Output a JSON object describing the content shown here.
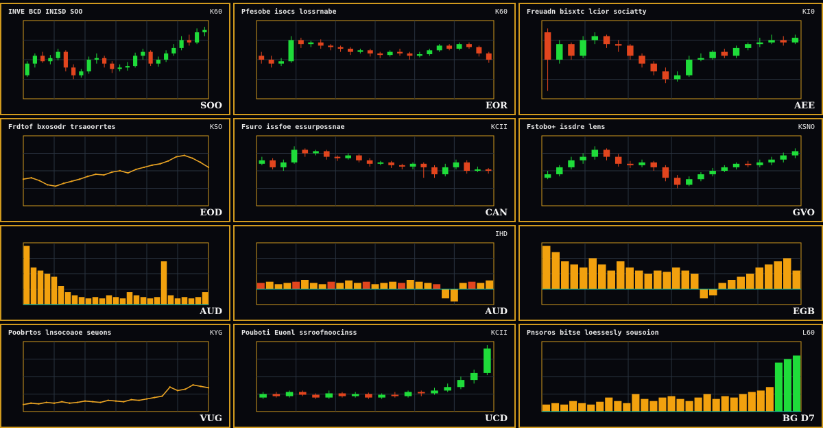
{
  "colors": {
    "background": "#05060a",
    "frame": "#d19a1e",
    "grid": "#2a3340",
    "up": "#1fdc3a",
    "down": "#e2451e",
    "orange": "#f2a10e",
    "line": "#e8a52a",
    "teal": "#19b6a0"
  },
  "chart_data": [
    {
      "id": "p1",
      "type": "candlestick",
      "title": "INVE BCD INISD SOO",
      "code": "K60",
      "currency": "SOO",
      "y": [
        0,
        100
      ],
      "series": [
        [
          30,
          45,
          28,
          48
        ],
        [
          45,
          55,
          40,
          58
        ],
        [
          55,
          48,
          46,
          60
        ],
        [
          48,
          52,
          44,
          56
        ],
        [
          52,
          60,
          49,
          64
        ],
        [
          60,
          40,
          35,
          62
        ],
        [
          40,
          30,
          25,
          44
        ],
        [
          30,
          35,
          27,
          38
        ],
        [
          35,
          50,
          32,
          54
        ],
        [
          50,
          52,
          45,
          58
        ],
        [
          52,
          45,
          40,
          55
        ],
        [
          45,
          38,
          33,
          48
        ],
        [
          38,
          40,
          35,
          44
        ],
        [
          40,
          42,
          36,
          47
        ],
        [
          42,
          55,
          40,
          59
        ],
        [
          55,
          60,
          50,
          64
        ],
        [
          60,
          45,
          42,
          62
        ],
        [
          45,
          50,
          41,
          54
        ],
        [
          50,
          58,
          47,
          62
        ],
        [
          58,
          65,
          55,
          70
        ],
        [
          65,
          75,
          62,
          80
        ],
        [
          75,
          72,
          68,
          82
        ],
        [
          72,
          85,
          70,
          90
        ],
        [
          85,
          88,
          80,
          92
        ]
      ]
    },
    {
      "id": "p2",
      "type": "candlestick",
      "title": "Pfesobe isocs lossrnabe",
      "code": "K60",
      "currency": "EOR",
      "y": [
        0,
        100
      ],
      "series": [
        [
          55,
          50,
          45,
          60
        ],
        [
          50,
          45,
          40,
          55
        ],
        [
          45,
          48,
          42,
          52
        ],
        [
          48,
          75,
          46,
          80
        ],
        [
          75,
          70,
          65,
          78
        ],
        [
          70,
          72,
          66,
          74
        ],
        [
          72,
          68,
          64,
          76
        ],
        [
          68,
          66,
          62,
          70
        ],
        [
          66,
          64,
          60,
          68
        ],
        [
          64,
          60,
          56,
          66
        ],
        [
          60,
          62,
          58,
          64
        ],
        [
          62,
          58,
          54,
          64
        ],
        [
          58,
          56,
          52,
          60
        ],
        [
          56,
          60,
          54,
          62
        ],
        [
          60,
          58,
          55,
          64
        ],
        [
          58,
          55,
          50,
          60
        ],
        [
          55,
          57,
          53,
          60
        ],
        [
          57,
          62,
          55,
          64
        ],
        [
          62,
          68,
          60,
          70
        ],
        [
          68,
          64,
          62,
          70
        ],
        [
          64,
          70,
          62,
          72
        ],
        [
          70,
          66,
          64,
          72
        ],
        [
          66,
          58,
          54,
          68
        ],
        [
          58,
          50,
          46,
          60
        ]
      ]
    },
    {
      "id": "p3",
      "type": "candlestick",
      "title": "Freuadn bisxtc lcior sociatty",
      "code": "KI0",
      "currency": "AEE",
      "y": [
        0,
        100
      ],
      "series": [
        [
          85,
          50,
          10,
          90
        ],
        [
          50,
          70,
          45,
          75
        ],
        [
          70,
          55,
          50,
          72
        ],
        [
          55,
          75,
          52,
          80
        ],
        [
          75,
          80,
          70,
          85
        ],
        [
          80,
          70,
          65,
          82
        ],
        [
          70,
          68,
          60,
          75
        ],
        [
          68,
          55,
          50,
          70
        ],
        [
          55,
          45,
          40,
          58
        ],
        [
          45,
          35,
          30,
          48
        ],
        [
          35,
          25,
          20,
          40
        ],
        [
          25,
          30,
          22,
          35
        ],
        [
          30,
          50,
          28,
          55
        ],
        [
          50,
          52,
          48,
          58
        ],
        [
          52,
          60,
          50,
          62
        ],
        [
          60,
          55,
          52,
          64
        ],
        [
          55,
          65,
          52,
          68
        ],
        [
          65,
          70,
          62,
          72
        ],
        [
          70,
          72,
          66,
          78
        ],
        [
          72,
          75,
          70,
          82
        ],
        [
          75,
          72,
          68,
          80
        ],
        [
          72,
          78,
          70,
          82
        ]
      ]
    },
    {
      "id": "p4",
      "type": "line",
      "title": "Frdtof bxosodr trsaoorrtes",
      "code": "KSO",
      "currency": "EOD",
      "y": [
        0,
        100
      ],
      "values": [
        38,
        40,
        36,
        30,
        28,
        32,
        35,
        38,
        42,
        45,
        44,
        48,
        50,
        47,
        52,
        55,
        58,
        60,
        64,
        70,
        72,
        68,
        62,
        55
      ]
    },
    {
      "id": "p5",
      "type": "candlestick",
      "title": "Fsuro issfoe essurpossnae",
      "code": "KCII",
      "currency": "CAN",
      "y": [
        0,
        100
      ],
      "series": [
        [
          60,
          65,
          58,
          70
        ],
        [
          65,
          55,
          52,
          68
        ],
        [
          55,
          62,
          50,
          66
        ],
        [
          62,
          80,
          60,
          85
        ],
        [
          80,
          75,
          70,
          82
        ],
        [
          75,
          78,
          72,
          80
        ],
        [
          78,
          70,
          66,
          80
        ],
        [
          70,
          68,
          64,
          72
        ],
        [
          68,
          72,
          66,
          75
        ],
        [
          72,
          65,
          62,
          74
        ],
        [
          65,
          60,
          56,
          68
        ],
        [
          60,
          62,
          58,
          64
        ],
        [
          62,
          58,
          54,
          64
        ],
        [
          58,
          56,
          52,
          60
        ],
        [
          56,
          60,
          52,
          62
        ],
        [
          60,
          55,
          40,
          62
        ],
        [
          55,
          45,
          40,
          58
        ],
        [
          45,
          55,
          42,
          60
        ],
        [
          55,
          62,
          52,
          66
        ],
        [
          62,
          50,
          46,
          65
        ],
        [
          50,
          52,
          48,
          56
        ],
        [
          52,
          50,
          46,
          54
        ]
      ]
    },
    {
      "id": "p6",
      "type": "candlestick",
      "title": "Fstobo+ issdre lens",
      "code": "KSNO",
      "currency": "GVO",
      "y": [
        0,
        100
      ],
      "series": [
        [
          40,
          45,
          38,
          50
        ],
        [
          45,
          55,
          42,
          58
        ],
        [
          55,
          65,
          52,
          70
        ],
        [
          65,
          70,
          60,
          75
        ],
        [
          70,
          80,
          66,
          85
        ],
        [
          80,
          70,
          65,
          82
        ],
        [
          70,
          60,
          56,
          74
        ],
        [
          60,
          58,
          54,
          64
        ],
        [
          58,
          62,
          55,
          66
        ],
        [
          62,
          55,
          50,
          64
        ],
        [
          55,
          40,
          35,
          58
        ],
        [
          40,
          30,
          25,
          44
        ],
        [
          30,
          38,
          28,
          42
        ],
        [
          38,
          45,
          35,
          48
        ],
        [
          45,
          50,
          42,
          54
        ],
        [
          50,
          55,
          48,
          58
        ],
        [
          55,
          60,
          52,
          62
        ],
        [
          60,
          58,
          55,
          64
        ],
        [
          58,
          62,
          55,
          66
        ],
        [
          62,
          66,
          58,
          70
        ],
        [
          66,
          72,
          62,
          76
        ],
        [
          72,
          78,
          68,
          82
        ]
      ]
    },
    {
      "id": "p7",
      "type": "bar",
      "title": "",
      "code": "",
      "currency": "AUD",
      "y": [
        0,
        100
      ],
      "values": [
        95,
        60,
        55,
        50,
        45,
        30,
        20,
        15,
        12,
        10,
        12,
        10,
        15,
        12,
        10,
        20,
        15,
        12,
        10,
        12,
        70,
        15,
        10,
        12,
        10,
        12,
        20
      ]
    },
    {
      "id": "p8",
      "type": "bar",
      "title": "",
      "code": "IHD",
      "currency": "AUD",
      "y": [
        0,
        100
      ],
      "values": [
        10,
        12,
        8,
        10,
        12,
        15,
        10,
        8,
        12,
        10,
        14,
        10,
        12,
        8,
        10,
        12,
        10,
        15,
        12,
        10,
        8,
        -15,
        -20,
        10,
        12,
        10,
        14
      ]
    },
    {
      "id": "p9",
      "type": "bar",
      "title": "",
      "code": "",
      "currency": "EGB",
      "y": [
        0,
        100
      ],
      "values": [
        70,
        60,
        45,
        40,
        35,
        50,
        40,
        30,
        45,
        35,
        30,
        25,
        30,
        28,
        35,
        30,
        25,
        -15,
        -10,
        10,
        15,
        20,
        25,
        35,
        40,
        45,
        50,
        30
      ]
    },
    {
      "id": "p10",
      "type": "line",
      "title": "Poobrtos lnsocoaoe seuons",
      "code": "KYG",
      "currency": "VUG",
      "y": [
        0,
        100
      ],
      "values": [
        10,
        12,
        11,
        13,
        12,
        14,
        12,
        13,
        15,
        14,
        13,
        16,
        15,
        14,
        17,
        16,
        18,
        20,
        22,
        35,
        30,
        32,
        38,
        36,
        34
      ]
    },
    {
      "id": "p11",
      "type": "candlestick",
      "title": "Pouboti Euonl ssroofnoocinss",
      "code": "KCII",
      "currency": "UCD",
      "y": [
        0,
        100
      ],
      "series": [
        [
          20,
          25,
          18,
          28
        ],
        [
          25,
          22,
          20,
          28
        ],
        [
          22,
          28,
          20,
          30
        ],
        [
          28,
          24,
          22,
          30
        ],
        [
          24,
          20,
          18,
          26
        ],
        [
          20,
          26,
          18,
          30
        ],
        [
          26,
          22,
          20,
          28
        ],
        [
          22,
          25,
          20,
          28
        ],
        [
          25,
          20,
          18,
          27
        ],
        [
          20,
          24,
          18,
          26
        ],
        [
          24,
          22,
          20,
          28
        ],
        [
          22,
          28,
          20,
          30
        ],
        [
          28,
          26,
          22,
          30
        ],
        [
          26,
          30,
          24,
          34
        ],
        [
          30,
          35,
          28,
          40
        ],
        [
          35,
          45,
          32,
          50
        ],
        [
          45,
          55,
          40,
          60
        ],
        [
          55,
          90,
          52,
          95
        ]
      ]
    },
    {
      "id": "p12",
      "type": "bar",
      "title": "Pnsoros bitse loessesly sousoion",
      "code": "L60",
      "currency": "BG D7",
      "y": [
        0,
        100
      ],
      "values": [
        10,
        12,
        10,
        15,
        12,
        10,
        14,
        20,
        15,
        12,
        25,
        18,
        15,
        20,
        22,
        18,
        15,
        20,
        25,
        18,
        22,
        20,
        25,
        28,
        30,
        35,
        70,
        75,
        80
      ]
    }
  ]
}
